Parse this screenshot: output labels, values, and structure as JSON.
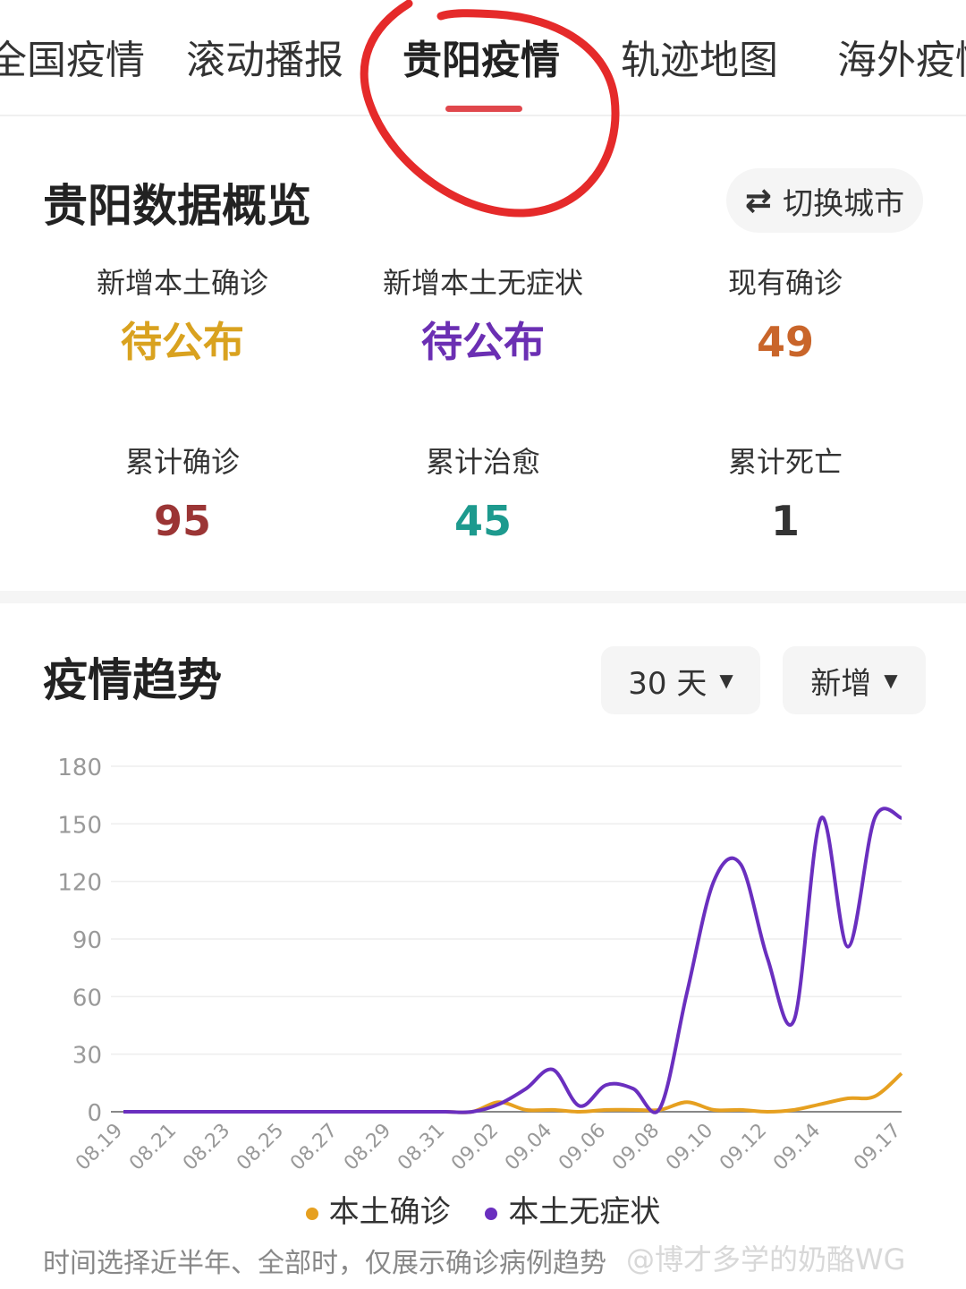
{
  "tabs": [
    {
      "label": "全国疫情",
      "active": false
    },
    {
      "label": "滚动播报",
      "active": false
    },
    {
      "label": "贵阳疫情",
      "active": true
    },
    {
      "label": "轨迹地图",
      "active": false
    },
    {
      "label": "海外疫情",
      "active": false
    }
  ],
  "overview": {
    "title": "贵阳数据概览",
    "switch_label": "切换城市",
    "switch_icon": "swap-arrows-icon",
    "stats": [
      {
        "label": "新增本土确诊",
        "value": "待公布",
        "color": "#d9a21f"
      },
      {
        "label": "新增本土无症状",
        "value": "待公布",
        "color": "#6b2fb3"
      },
      {
        "label": "现有确诊",
        "value": "49",
        "color": "#c9652a"
      },
      {
        "label": "累计确诊",
        "value": "95",
        "color": "#9b3535"
      },
      {
        "label": "累计治愈",
        "value": "45",
        "color": "#1d9a8e"
      },
      {
        "label": "累计死亡",
        "value": "1",
        "color": "#333333"
      }
    ]
  },
  "trend": {
    "title": "疫情趋势",
    "range_select": "30 天",
    "mode_select": "新增",
    "footnote": "时间选择近半年、全部时，仅展示确诊病例趋势",
    "watermark": "@博才多学的奶酪WG"
  },
  "chart_data": {
    "type": "line",
    "x": [
      "08.19",
      "08.20",
      "08.21",
      "08.22",
      "08.23",
      "08.24",
      "08.25",
      "08.26",
      "08.27",
      "08.28",
      "08.29",
      "08.30",
      "08.31",
      "09.01",
      "09.02",
      "09.03",
      "09.04",
      "09.05",
      "09.06",
      "09.07",
      "09.08",
      "09.09",
      "09.10",
      "09.11",
      "09.12",
      "09.13",
      "09.14",
      "09.15",
      "09.16",
      "09.17"
    ],
    "x_tick_labels": [
      "08.19",
      "08.21",
      "08.23",
      "08.25",
      "08.27",
      "08.29",
      "08.31",
      "09.02",
      "09.04",
      "09.06",
      "09.08",
      "09.10",
      "09.12",
      "09.14",
      "09.17"
    ],
    "ylim": [
      0,
      180
    ],
    "yticks": [
      0,
      30,
      60,
      90,
      120,
      150,
      180
    ],
    "grid": true,
    "legend_position": "bottom",
    "series": [
      {
        "name": "本土确诊",
        "color": "#e6a020",
        "values": [
          0,
          0,
          0,
          0,
          0,
          0,
          0,
          0,
          0,
          0,
          0,
          0,
          0,
          0,
          5,
          1,
          1,
          0,
          1,
          1,
          1,
          5,
          1,
          1,
          0,
          1,
          4,
          7,
          8,
          20
        ]
      },
      {
        "name": "本土无症状",
        "color": "#6a2fbf",
        "values": [
          0,
          0,
          0,
          0,
          0,
          0,
          0,
          0,
          0,
          0,
          0,
          0,
          0,
          0,
          4,
          12,
          22,
          3,
          14,
          12,
          2,
          62,
          120,
          129,
          80,
          48,
          153,
          86,
          153,
          153
        ]
      }
    ]
  }
}
